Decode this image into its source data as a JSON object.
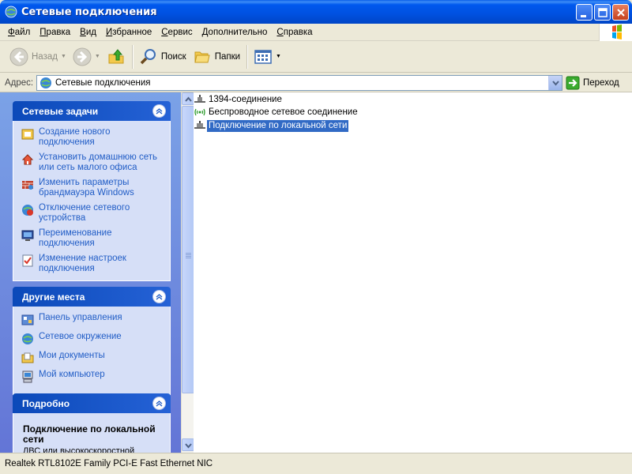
{
  "window": {
    "title": "Сетевые подключения"
  },
  "menu": [
    "Файл",
    "Правка",
    "Вид",
    "Избранное",
    "Сервис",
    "Дополнительно",
    "Справка"
  ],
  "toolbar": {
    "back_label": "Назад",
    "search_label": "Поиск",
    "folders_label": "Папки"
  },
  "address": {
    "label": "Адрес:",
    "value": "Сетевые подключения",
    "go_label": "Переход"
  },
  "taskpane": {
    "network_tasks": {
      "title": "Сетевые задачи",
      "items": [
        "Создание нового подключения",
        "Установить домашнюю сеть или сеть малого офиса",
        "Изменить параметры брандмауэра Windows",
        "Отключение сетевого устройства",
        "Переименование подключения",
        "Изменение настроек подключения"
      ]
    },
    "other_places": {
      "title": "Другие места",
      "items": [
        "Панель управления",
        "Сетевое окружение",
        "Мои документы",
        "Мой компьютер"
      ]
    },
    "details": {
      "title": "Подробно",
      "name": "Подключение по локальной сети",
      "sub": "ЛВС или высокоскоростной"
    }
  },
  "connections": [
    {
      "name": "1394-соединение",
      "selected": false
    },
    {
      "name": "Беспроводное сетевое соединение",
      "selected": false
    },
    {
      "name": "Подключение по локальной сети",
      "selected": true
    }
  ],
  "status": {
    "text": "Realtek RTL8102E Family PCI-E Fast Ethernet NIC"
  }
}
